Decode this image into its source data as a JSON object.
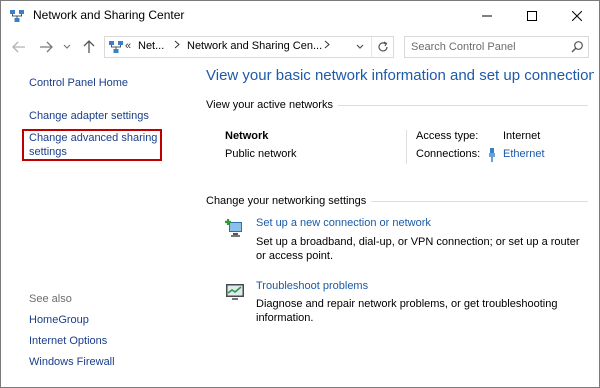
{
  "window": {
    "title": "Network and Sharing Center"
  },
  "nav": {
    "breadcrumb_overflow": "«",
    "crumbs": [
      "Net...",
      "Network and Sharing Cen..."
    ],
    "search_placeholder": "Search Control Panel"
  },
  "sidebar": {
    "home": "Control Panel Home",
    "change_adapter": "Change adapter settings",
    "change_advanced": "Change advanced sharing settings",
    "see_also_heading": "See also",
    "see_also": [
      "HomeGroup",
      "Internet Options",
      "Windows Firewall"
    ]
  },
  "main": {
    "title": "View your basic network information and set up connections",
    "active_networks_heading": "View your active networks",
    "network": {
      "name": "Network",
      "category": "Public network",
      "access_type_label": "Access type:",
      "access_type_value": "Internet",
      "connections_label": "Connections:",
      "connections_value": "Ethernet"
    },
    "change_settings_heading": "Change your networking settings",
    "tasks": [
      {
        "icon": "new-connection-icon",
        "link": "Set up a new connection or network",
        "description": "Set up a broadband, dial-up, or VPN connection; or set up a router or access point."
      },
      {
        "icon": "troubleshoot-icon",
        "link": "Troubleshoot problems",
        "description": "Diagnose and repair network problems, or get troubleshooting information."
      }
    ]
  },
  "colors": {
    "link": "#1a5aa8",
    "title": "#1e5aa8",
    "highlight": "#c00000"
  }
}
